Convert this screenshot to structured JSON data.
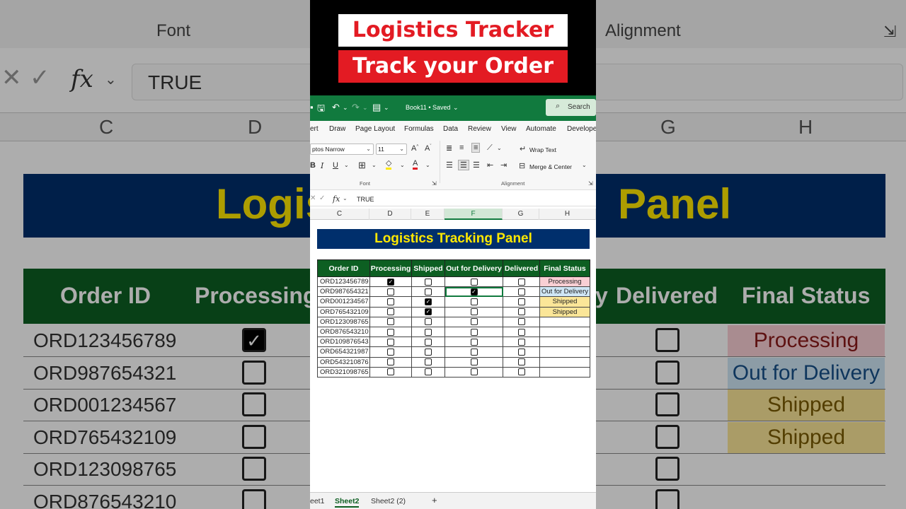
{
  "banner": {
    "line1": "Logistics Tracker",
    "line2": "Track your Order"
  },
  "window": {
    "doc_title": "Book11 • Saved",
    "search_label": "Search"
  },
  "ribbon_tabs": [
    "ert",
    "Draw",
    "Page Layout",
    "Formulas",
    "Data",
    "Review",
    "View",
    "Automate",
    "Develope"
  ],
  "ribbon": {
    "font_name": "ptos Narrow",
    "font_size": "11",
    "wrap_text": "Wrap Text",
    "merge_center": "Merge & Center",
    "group_font": "Font",
    "group_alignment": "Alignment"
  },
  "formula_bar": {
    "value": "TRUE",
    "fx": "fx"
  },
  "columns": [
    "C",
    "D",
    "E",
    "F",
    "G",
    "H"
  ],
  "panel_title": "Logistics Tracking Panel",
  "table": {
    "headers": [
      "Order ID",
      "Processing",
      "Shipped",
      "Out for Delivery",
      "Delivered",
      "Final Status"
    ],
    "rows": [
      {
        "id": "ORD123456789",
        "processing": true,
        "shipped": false,
        "out": false,
        "delivered": false,
        "status": "Processing"
      },
      {
        "id": "ORD987654321",
        "processing": false,
        "shipped": false,
        "out": true,
        "delivered": false,
        "status": "Out for Delivery"
      },
      {
        "id": "ORD001234567",
        "processing": false,
        "shipped": true,
        "out": false,
        "delivered": false,
        "status": "Shipped"
      },
      {
        "id": "ORD765432109",
        "processing": false,
        "shipped": true,
        "out": false,
        "delivered": false,
        "status": "Shipped"
      },
      {
        "id": "ORD123098765",
        "processing": false,
        "shipped": false,
        "out": false,
        "delivered": false,
        "status": ""
      },
      {
        "id": "ORD876543210",
        "processing": false,
        "shipped": false,
        "out": false,
        "delivered": false,
        "status": ""
      },
      {
        "id": "ORD109876543",
        "processing": false,
        "shipped": false,
        "out": false,
        "delivered": false,
        "status": ""
      },
      {
        "id": "ORD654321987",
        "processing": false,
        "shipped": false,
        "out": false,
        "delivered": false,
        "status": ""
      },
      {
        "id": "ORD543210876",
        "processing": false,
        "shipped": false,
        "out": false,
        "delivered": false,
        "status": ""
      },
      {
        "id": "ORD321098765",
        "processing": false,
        "shipped": false,
        "out": false,
        "delivered": false,
        "status": ""
      }
    ]
  },
  "sheet_tabs": [
    "eet1",
    "Sheet2",
    "Sheet2 (2)",
    "+"
  ],
  "background": {
    "ribbon_font": "Font",
    "ribbon_alignment": "Alignment",
    "formula_value": "TRUE",
    "col_labels": [
      "C",
      "D",
      "G",
      "H"
    ],
    "title_left": "Logis",
    "title_right": "Panel",
    "headers": [
      "Order ID",
      "Processing",
      "y",
      "Delivered",
      "Final Status"
    ],
    "rows": [
      {
        "id": "ORD123456789",
        "checked": true,
        "status": "Processing",
        "kind": "processing"
      },
      {
        "id": "ORD987654321",
        "checked": false,
        "status": "Out for Delivery",
        "kind": "out"
      },
      {
        "id": "ORD001234567",
        "checked": false,
        "status": "Shipped",
        "kind": "shipped"
      },
      {
        "id": "ORD765432109",
        "checked": false,
        "status": "Shipped",
        "kind": "shipped"
      },
      {
        "id": "ORD123098765",
        "checked": false,
        "status": "",
        "kind": ""
      },
      {
        "id": "ORD876543210",
        "checked": false,
        "status": "",
        "kind": ""
      }
    ]
  },
  "colors": {
    "excel_green": "#117a3e",
    "header_green": "#0d5f22",
    "title_navy": "#002f6c",
    "title_yellow": "#ffe800",
    "banner_red": "#e31b23"
  }
}
